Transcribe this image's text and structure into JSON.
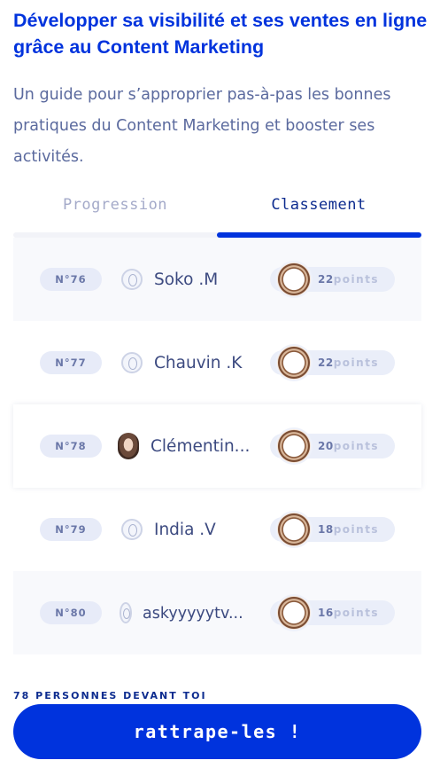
{
  "header": {
    "title": "Développer sa visibilité et ses ventes en ligne grâce au Content Marketing",
    "subtitle": "Un guide pour s’approprier pas-à-pas les bonnes pratiques du Content Marketing et booster ses activités."
  },
  "tabs": [
    {
      "label": "Progression",
      "active": false
    },
    {
      "label": "Classement",
      "active": true
    }
  ],
  "accent_color": "#0033dd",
  "ranking": [
    {
      "rank": "N°76",
      "name": "Soko .M",
      "points": "22",
      "unit": "points",
      "avatar": "default-avatar-icon"
    },
    {
      "rank": "N°77",
      "name": "Chauvin .K",
      "points": "22",
      "unit": "points",
      "avatar": "default-avatar-icon"
    },
    {
      "rank": "N°78",
      "name": "Clémentin...",
      "points": "20",
      "unit": "points",
      "avatar": "photo"
    },
    {
      "rank": "N°79",
      "name": "India .V",
      "points": "18",
      "unit": "points",
      "avatar": "default-avatar-icon"
    },
    {
      "rank": "N°80",
      "name": "askyyyyytv...",
      "points": "16",
      "unit": "points",
      "avatar": "default-avatar-icon"
    }
  ],
  "footer": {
    "ahead_text": "78 PERSONNES DEVANT TOI",
    "cta_label": "rattrape-les !"
  }
}
